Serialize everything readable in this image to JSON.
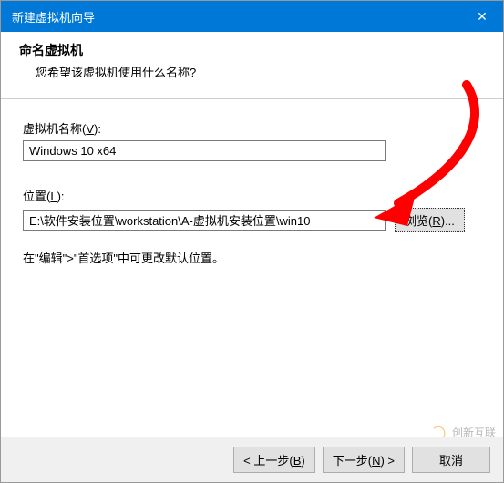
{
  "window": {
    "title": "新建虚拟机向导",
    "close_glyph": "✕"
  },
  "header": {
    "title": "命名虚拟机",
    "subtitle": "您希望该虚拟机使用什么名称?"
  },
  "fields": {
    "name_label_pre": "虚拟机名称(",
    "name_label_key": "V",
    "name_label_post": "):",
    "name_value": "Windows 10 x64",
    "loc_label_pre": "位置(",
    "loc_label_key": "L",
    "loc_label_post": "):",
    "loc_value": "E:\\软件安装位置\\workstation\\A-虚拟机安装位置\\win10",
    "browse_label_pre": "浏览(",
    "browse_label_key": "R",
    "browse_label_post": ")..."
  },
  "hint": "在\"编辑\">\"首选项\"中可更改默认位置。",
  "footer": {
    "back_pre": "< 上一步(",
    "back_key": "B",
    "back_post": ")",
    "next_pre": "下一步(",
    "next_key": "N",
    "next_post": ") >",
    "cancel": "取消"
  },
  "watermark": {
    "text": "创新互联"
  },
  "annotation": {
    "arrow_color": "#ff0000"
  }
}
